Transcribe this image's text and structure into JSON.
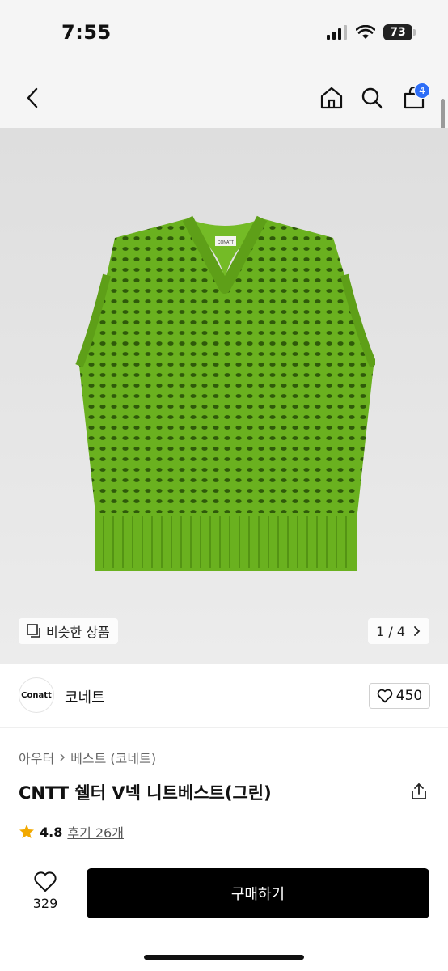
{
  "status_bar": {
    "time": "7:55",
    "battery": "73"
  },
  "nav": {
    "cart_count": "4"
  },
  "hero": {
    "similar_label": "비슷한 상품",
    "pagination": "1 / 4",
    "tag_text": "CONATT"
  },
  "brand": {
    "logo_text": "Conatt",
    "name": "코네트",
    "likes": "450"
  },
  "breadcrumb": {
    "category": "아우터",
    "subcategory": "베스트 (코네트)"
  },
  "product": {
    "title": "CNTT 쉘터 V넥 니트베스트(그린)",
    "rating": "4.8",
    "reviews": "후기 26개"
  },
  "bottom": {
    "wish_count": "329",
    "buy_label": "구매하기"
  },
  "colors": {
    "accent": "#2e6ef7",
    "star": "#f2a900",
    "vest_green": "#6ab11f"
  }
}
